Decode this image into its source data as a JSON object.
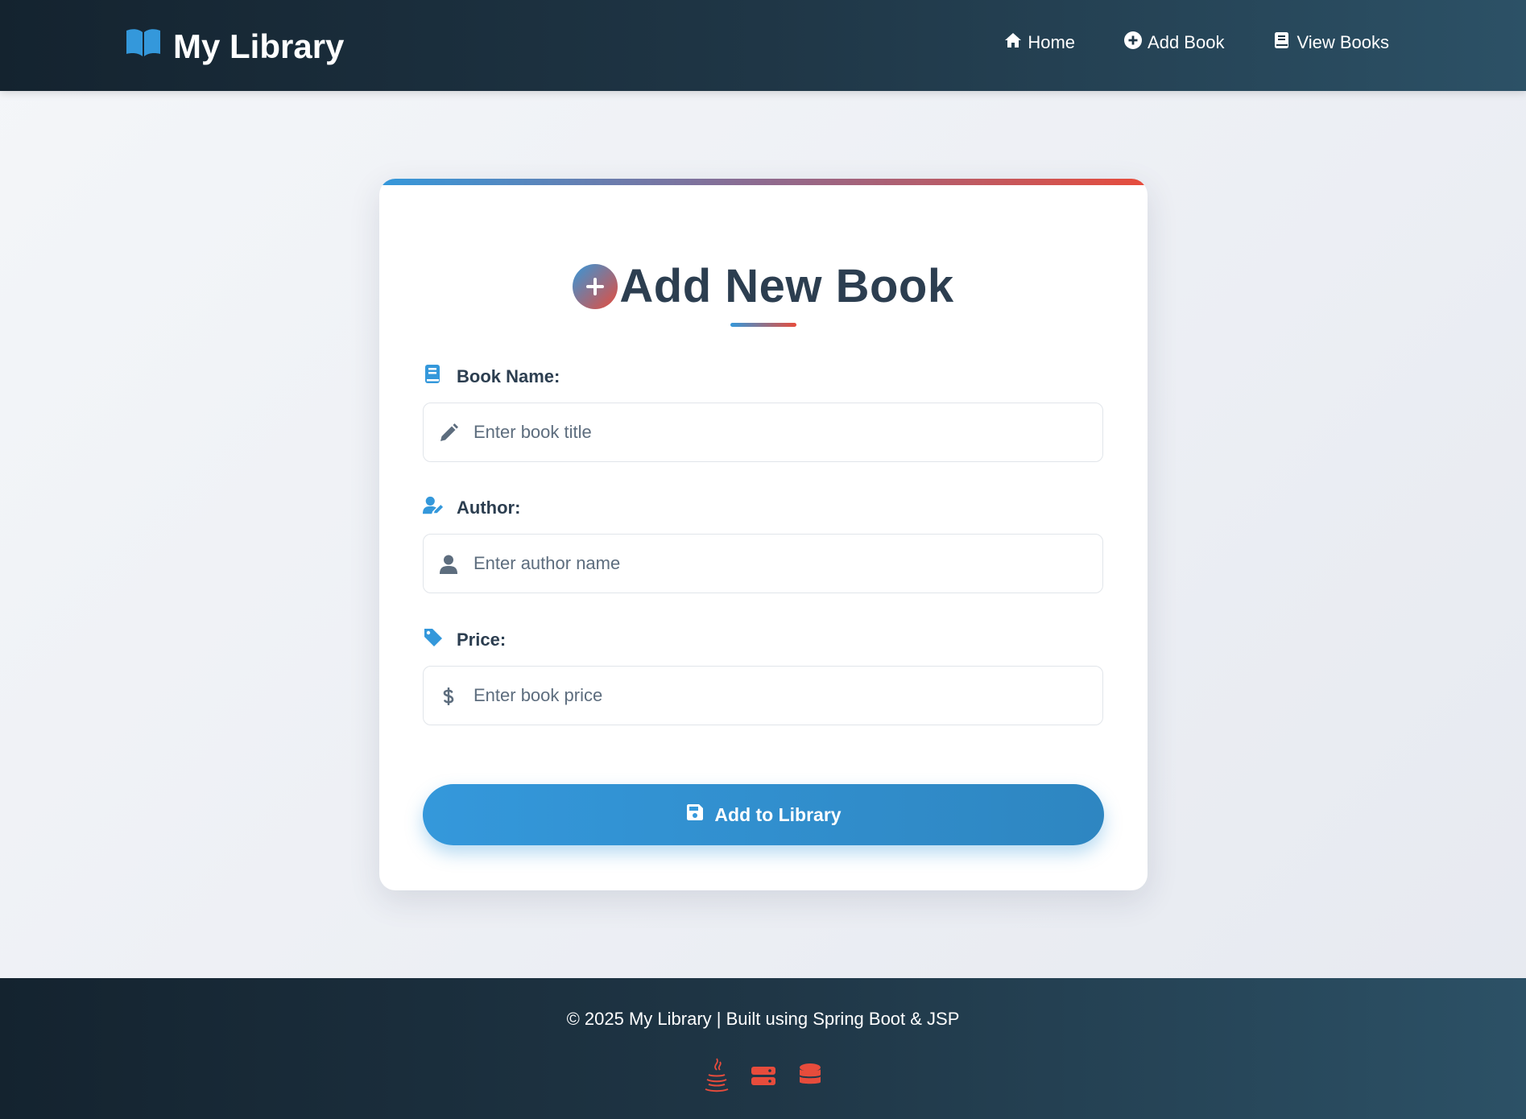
{
  "navbar": {
    "brand": "My Library",
    "links": [
      {
        "label": "Home",
        "icon": "home-icon"
      },
      {
        "label": "Add Book",
        "icon": "plus-circle-icon"
      },
      {
        "label": "View Books",
        "icon": "book-icon"
      }
    ]
  },
  "form": {
    "title": "Add New Book",
    "fields": [
      {
        "label": "Book Name:",
        "placeholder": "Enter book title",
        "label_icon": "book-icon",
        "input_icon": "pencil-icon"
      },
      {
        "label": "Author:",
        "placeholder": "Enter author name",
        "label_icon": "user-pen-icon",
        "input_icon": "user-icon"
      },
      {
        "label": "Price:",
        "placeholder": "Enter book price",
        "label_icon": "tag-icon",
        "input_icon": "dollar-icon"
      }
    ],
    "submit_label": "Add to Library"
  },
  "footer": {
    "text": "© 2025 My Library | Built using Spring Boot & JSP",
    "icons": [
      "java-icon",
      "server-icon",
      "database-icon"
    ]
  },
  "colors": {
    "accent": "#3498db",
    "accent_red": "#e74c3c",
    "text_dark": "#2c3e50",
    "nav_bg": "#1f3646"
  }
}
